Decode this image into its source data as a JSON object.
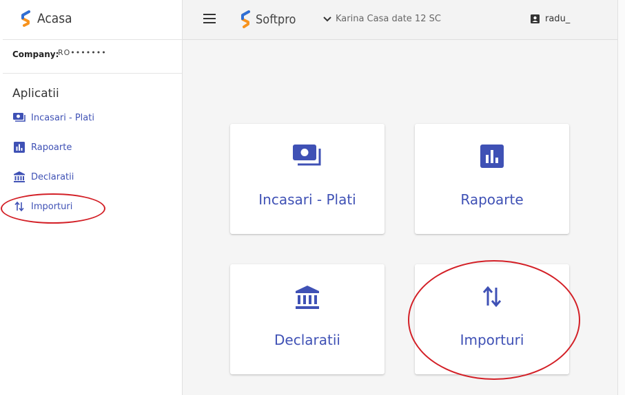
{
  "sidebar": {
    "brand": "Acasa",
    "company_label": "Company:",
    "company_value": "RO•••••••",
    "section_title": "Aplicatii",
    "items": [
      {
        "label": "Incasari - Plati",
        "icon": "cash-icon"
      },
      {
        "label": "Rapoarte",
        "icon": "bar-chart-icon"
      },
      {
        "label": "Declaratii",
        "icon": "bank-icon"
      },
      {
        "label": "Importuri",
        "icon": "import-arrows-icon"
      }
    ]
  },
  "topbar": {
    "brand": "Softpro",
    "database_label": "Karina Casa date 12 SC",
    "user_name": "radu_"
  },
  "cards": [
    {
      "label": "Incasari - Plati",
      "icon": "cash-icon"
    },
    {
      "label": "Rapoarte",
      "icon": "bar-chart-icon"
    },
    {
      "label": "Declaratii",
      "icon": "bank-icon"
    },
    {
      "label": "Importuri",
      "icon": "import-arrows-icon"
    }
  ],
  "colors": {
    "accent": "#3f51b5",
    "logo_orange": "#f7931e",
    "logo_blue": "#2f6fd6",
    "annotation": "#d31f26"
  }
}
